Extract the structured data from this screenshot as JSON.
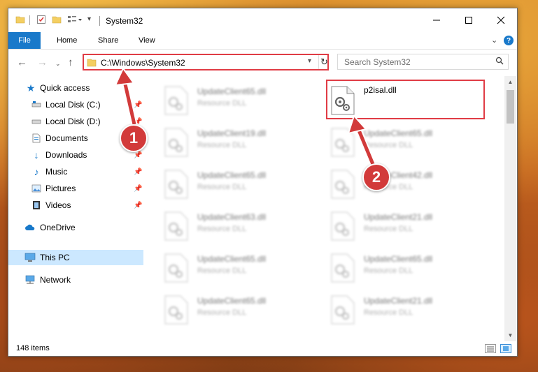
{
  "window": {
    "title": "System32"
  },
  "ribbon": {
    "tabs": [
      "File",
      "Home",
      "Share",
      "View"
    ],
    "help": "?"
  },
  "address": {
    "path": "C:\\Windows\\System32"
  },
  "search": {
    "placeholder": "Search System32"
  },
  "sidebar": {
    "items": [
      {
        "label": "Quick access"
      },
      {
        "label": "Local Disk (C:)"
      },
      {
        "label": "Local Disk (D:)"
      },
      {
        "label": "Documents"
      },
      {
        "label": "Downloads"
      },
      {
        "label": "Music"
      },
      {
        "label": "Pictures"
      },
      {
        "label": "Videos"
      },
      {
        "label": "OneDrive"
      },
      {
        "label": "This PC"
      },
      {
        "label": "Network"
      }
    ]
  },
  "files": {
    "col1": [
      {
        "name": "UpdateClient65.dll",
        "type": "Resource DLL"
      },
      {
        "name": "UpdateClient19.dll",
        "type": "Resource DLL"
      },
      {
        "name": "UpdateClient65.dll",
        "type": "Resource DLL"
      },
      {
        "name": "UpdateClient63.dll",
        "type": "Resource DLL"
      },
      {
        "name": "UpdateClient65.dll",
        "type": "Resource DLL"
      },
      {
        "name": "UpdateClient65.dll",
        "type": "Resource DLL"
      }
    ],
    "highlighted": {
      "name": "p2isal.dll"
    },
    "col2": [
      {
        "name": "UpdateClient65.dll",
        "type": "Resource DLL"
      },
      {
        "name": "UpdateClient42.dll",
        "type": "Resource DLL"
      },
      {
        "name": "UpdateClient21.dll",
        "type": "Resource DLL"
      },
      {
        "name": "UpdateClient65.dll",
        "type": "Resource DLL"
      },
      {
        "name": "UpdateClient21.dll",
        "type": "Resource DLL"
      }
    ]
  },
  "status": {
    "items": "148 items"
  },
  "callouts": [
    "1",
    "2"
  ],
  "colors": {
    "accent": "#1979ca",
    "highlight": "#e03c45",
    "selection": "#cce8ff"
  }
}
